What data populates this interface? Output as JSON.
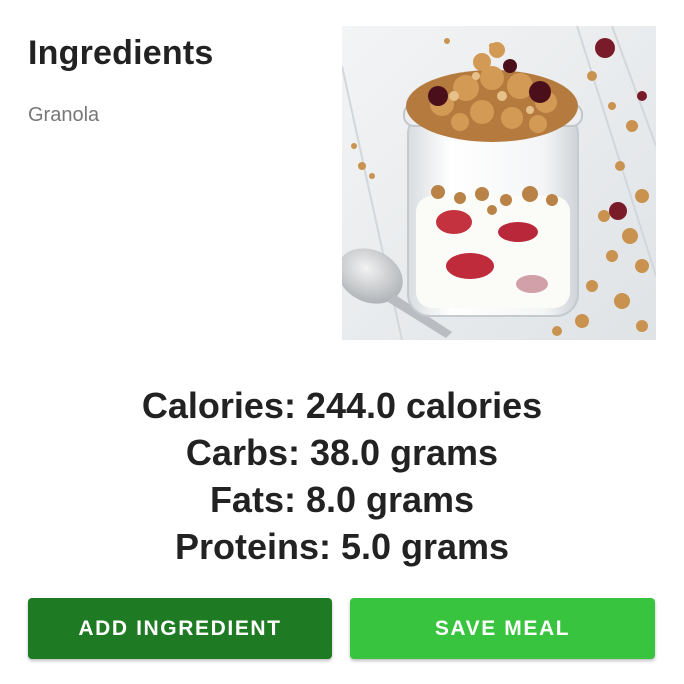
{
  "header": {
    "title": "Ingredients",
    "subtitle": "Granola"
  },
  "image": {
    "icon": "granola-yogurt-parfait-photo"
  },
  "nutrition": {
    "calories": "Calories: 244.0 calories",
    "carbs": "Carbs: 38.0 grams",
    "fats": "Fats: 8.0 grams",
    "proteins": "Proteins: 5.0 grams"
  },
  "actions": {
    "add_label": "ADD INGREDIENT",
    "save_label": "SAVE MEAL"
  },
  "colors": {
    "add_button": "#1f7a24",
    "save_button": "#39c43f",
    "text_primary": "#222222",
    "text_secondary": "#777777"
  }
}
